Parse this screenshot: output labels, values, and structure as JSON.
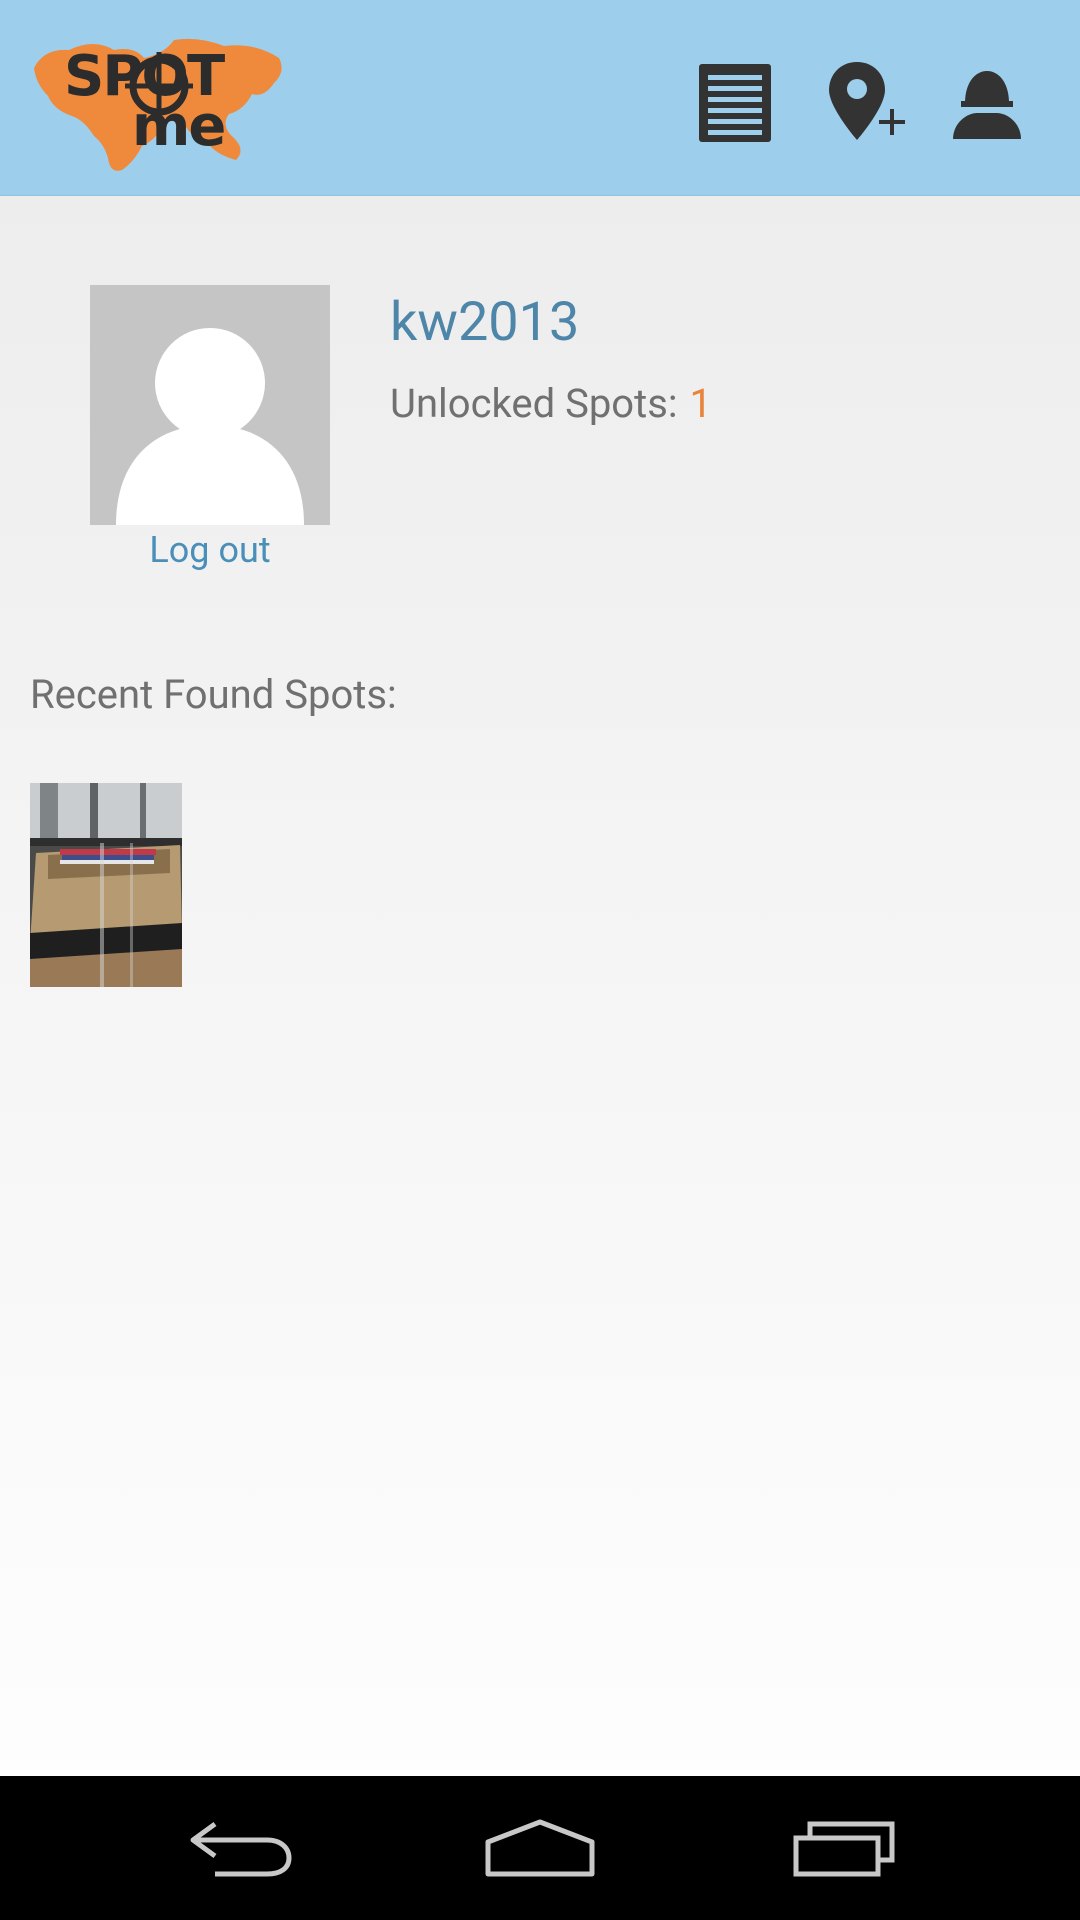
{
  "app": {
    "logo_text_line1": "SPOT",
    "logo_text_line2": "me",
    "accent": "#9dcfec",
    "logo_map_color": "#ef8a3d"
  },
  "nav": {
    "icons": [
      "list-icon",
      "add-location-icon",
      "profile-icon"
    ]
  },
  "profile": {
    "username": "kw2013",
    "unlocked_label": "Unlocked Spots:",
    "unlocked_count": "1",
    "logout_label": "Log out"
  },
  "recent": {
    "title": "Recent Found Spots:",
    "items": [
      {
        "thumb_icon": "spot-photo"
      }
    ]
  },
  "system_nav": {
    "icons": [
      "back-icon",
      "home-icon",
      "recents-icon"
    ]
  }
}
